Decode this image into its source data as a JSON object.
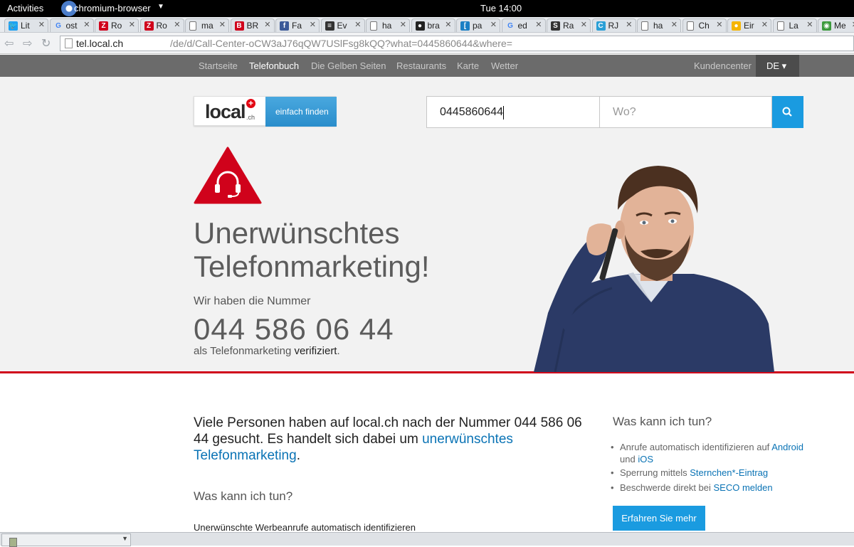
{
  "gnome": {
    "activities": "Activities",
    "app_name": "chromium-browser",
    "clock": "Tue 14:00"
  },
  "tabs": [
    {
      "title": "Lit",
      "fav": "twitter",
      "color": "#1da1f2"
    },
    {
      "title": "ost",
      "fav": "google",
      "color": "#4285f4"
    },
    {
      "title": "Ro",
      "fav": "z",
      "color": "#d0021b"
    },
    {
      "title": "Ro",
      "fav": "z",
      "color": "#d0021b"
    },
    {
      "title": "ma",
      "fav": "page",
      "color": "#ffffff"
    },
    {
      "title": "BR",
      "fav": "b",
      "color": "#d0021b"
    },
    {
      "title": "Fa",
      "fav": "f",
      "color": "#3b5998"
    },
    {
      "title": "Ev",
      "fav": "ev",
      "color": "#333333"
    },
    {
      "title": "ha",
      "fav": "page",
      "color": "#ffffff"
    },
    {
      "title": "bra",
      "fav": "github",
      "color": "#222222"
    },
    {
      "title": "pa",
      "fav": "bracket",
      "color": "#1a7fc4"
    },
    {
      "title": "ed",
      "fav": "google",
      "color": "#4285f4"
    },
    {
      "title": "Ra",
      "fav": "s",
      "color": "#333333"
    },
    {
      "title": "RJ",
      "fav": "c",
      "color": "#2a9fd6"
    },
    {
      "title": "ha",
      "fav": "page",
      "color": "#ffffff"
    },
    {
      "title": "Ch",
      "fav": "page",
      "color": "#ffffff"
    },
    {
      "title": "Eir",
      "fav": "circle",
      "color": "#f5b400"
    },
    {
      "title": "La",
      "fav": "page",
      "color": "#ffffff"
    },
    {
      "title": "Me",
      "fav": "globe",
      "color": "#3c9a3c"
    }
  ],
  "address": {
    "host": "tel.local.ch",
    "path": "/de/d/Call-Center-oCW3aJ76qQW7USlFsg8kQQ?what=0445860644&where="
  },
  "sitenav": {
    "items": [
      "Startseite",
      "Telefonbuch",
      "Die Gelben Seiten",
      "Restaurants",
      "Karte",
      "Wetter"
    ],
    "active": 1,
    "account": "Kundencenter",
    "lang": "DE ▾"
  },
  "logo": {
    "name": "local",
    "domain": ".ch",
    "tagline": "einfach finden"
  },
  "search": {
    "what_value": "0445860644",
    "where_placeholder": "Wo?"
  },
  "hero": {
    "title_line1": "Unerwünschtes",
    "title_line2": "Telefonmarketing!",
    "intro": "Wir haben die Nummer",
    "number": "044 586 06 44",
    "verified_prefix": "als Telefonmarketing ",
    "verified_word": "verifiziert",
    "verified_suffix": "."
  },
  "content": {
    "lead_text": "Viele Personen haben auf local.ch nach der Nummer 044 586 06 44 gesucht. Es handelt sich dabei um ",
    "lead_link": "unerwünschtes Telefonmarketing",
    "lead_end": ".",
    "section_heading": "Was kann ich tun?",
    "sub_line": "Unerwünschte Werbeanrufe automatisch identifizieren"
  },
  "sidebar": {
    "heading": "Was kann ich tun?",
    "item1_text": "Anrufe automatisch identifizieren auf ",
    "item1_link_android": "Android",
    "item1_und": "und ",
    "item1_link_ios": "iOS",
    "item2_text": "Sperrung mittels ",
    "item2_link": "Sternchen*-Eintrag",
    "item3_text": "Beschwerde direkt bei ",
    "item3_link": "SECO melden",
    "button": "Erfahren Sie mehr"
  },
  "colors": {
    "accent": "#1a9be0",
    "warning_red": "#d0021b",
    "nav_bg": "#6b6b6b",
    "link": "#0a73b5"
  }
}
